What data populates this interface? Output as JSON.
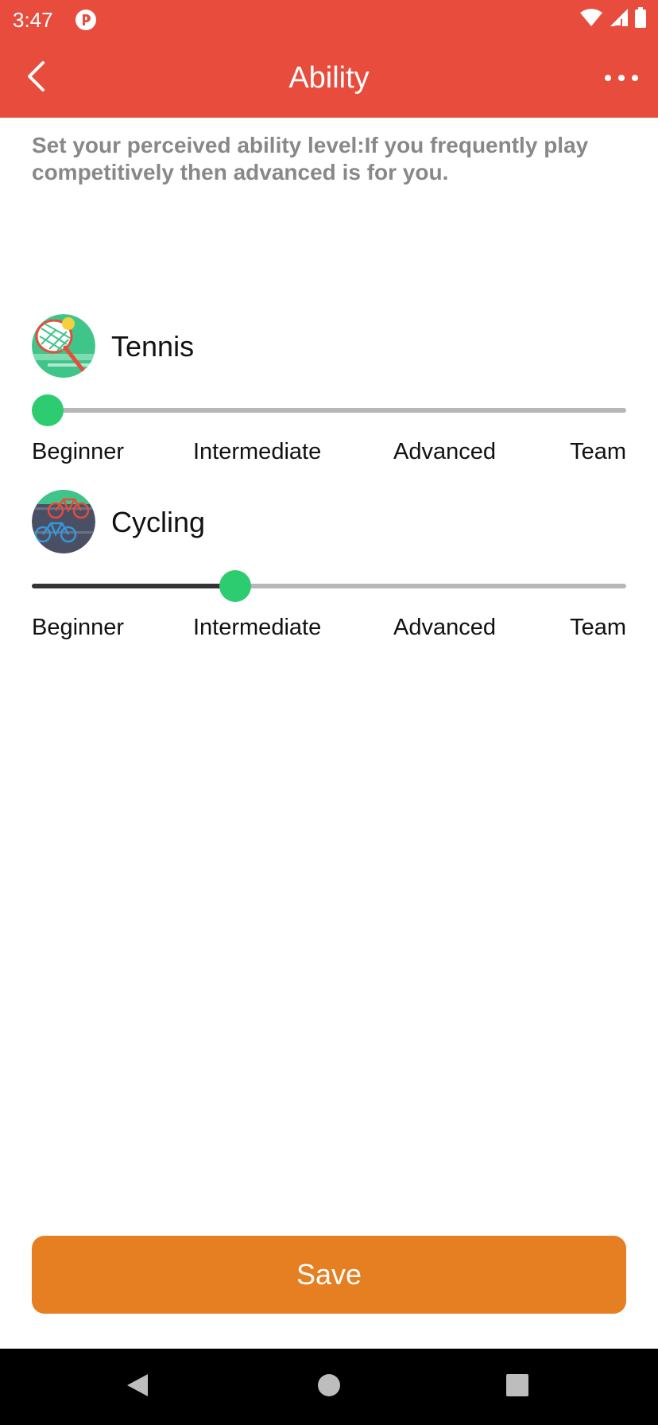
{
  "status_bar": {
    "time": "3:47",
    "app_icon": "p-circle-icon",
    "icons": [
      "wifi-icon",
      "signal-icon",
      "battery-icon"
    ]
  },
  "app_bar": {
    "title": "Ability",
    "back_icon": "chevron-left-icon",
    "more_icon": "more-horizontal-icon"
  },
  "instructions": "Set your perceived ability level:If you frequently play competitively then advanced is for you.",
  "levels": [
    "Beginner",
    "Intermediate",
    "Advanced",
    "Team"
  ],
  "sports": [
    {
      "name": "Tennis",
      "icon": "tennis-racket-icon",
      "level_index": 0,
      "level": "Beginner"
    },
    {
      "name": "Cycling",
      "icon": "bicycle-icon",
      "level_index": 1,
      "level": "Intermediate"
    }
  ],
  "save_label": "Save",
  "colors": {
    "primary": "#e84c3d",
    "accent": "#2ecc71",
    "button": "#e67e22",
    "muted_text": "#888888"
  },
  "nav_bar": {
    "icons": [
      "back-triangle-icon",
      "home-circle-icon",
      "recents-square-icon"
    ]
  }
}
